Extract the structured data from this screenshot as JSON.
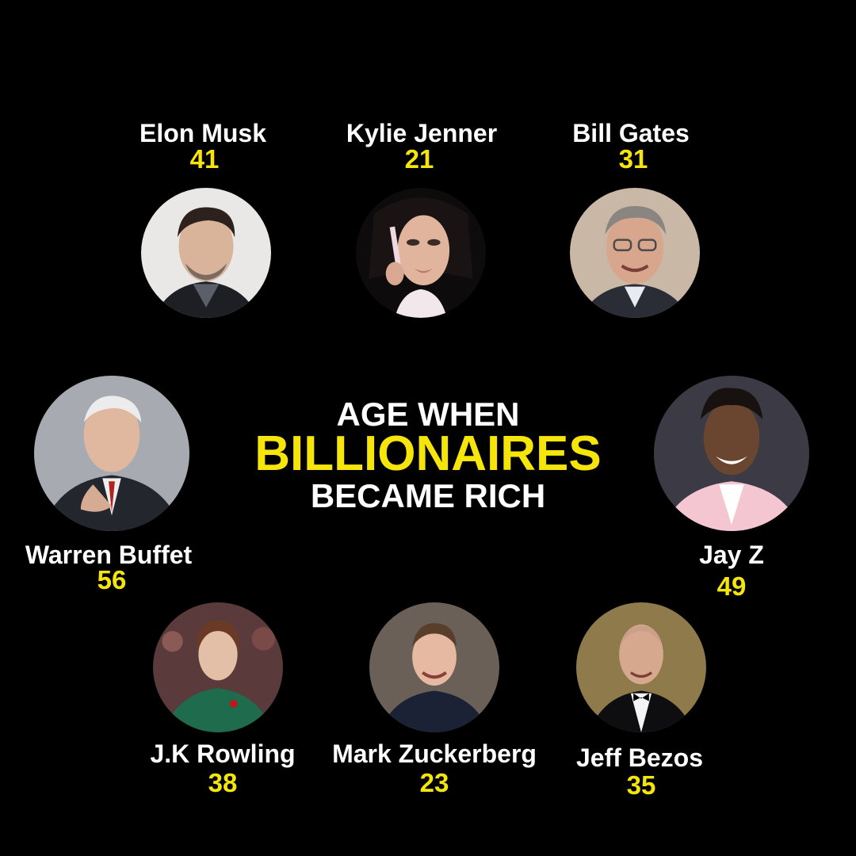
{
  "title": {
    "line1": "AGE WHEN",
    "line2": "BILLIONAIRES",
    "line3": "BECAME RICH"
  },
  "colors": {
    "accent": "#f5e50a",
    "text": "#ffffff",
    "background": "#000000"
  },
  "people": [
    {
      "name": "Elon Musk",
      "age": "41"
    },
    {
      "name": "Kylie Jenner",
      "age": "21"
    },
    {
      "name": "Bill Gates",
      "age": "31"
    },
    {
      "name": "Warren Buffet",
      "age": "56"
    },
    {
      "name": "Jay Z",
      "age": "49"
    },
    {
      "name": "J.K Rowling",
      "age": "38"
    },
    {
      "name": "Mark Zuckerberg",
      "age": "23"
    },
    {
      "name": "Jeff Bezos",
      "age": "35"
    }
  ]
}
